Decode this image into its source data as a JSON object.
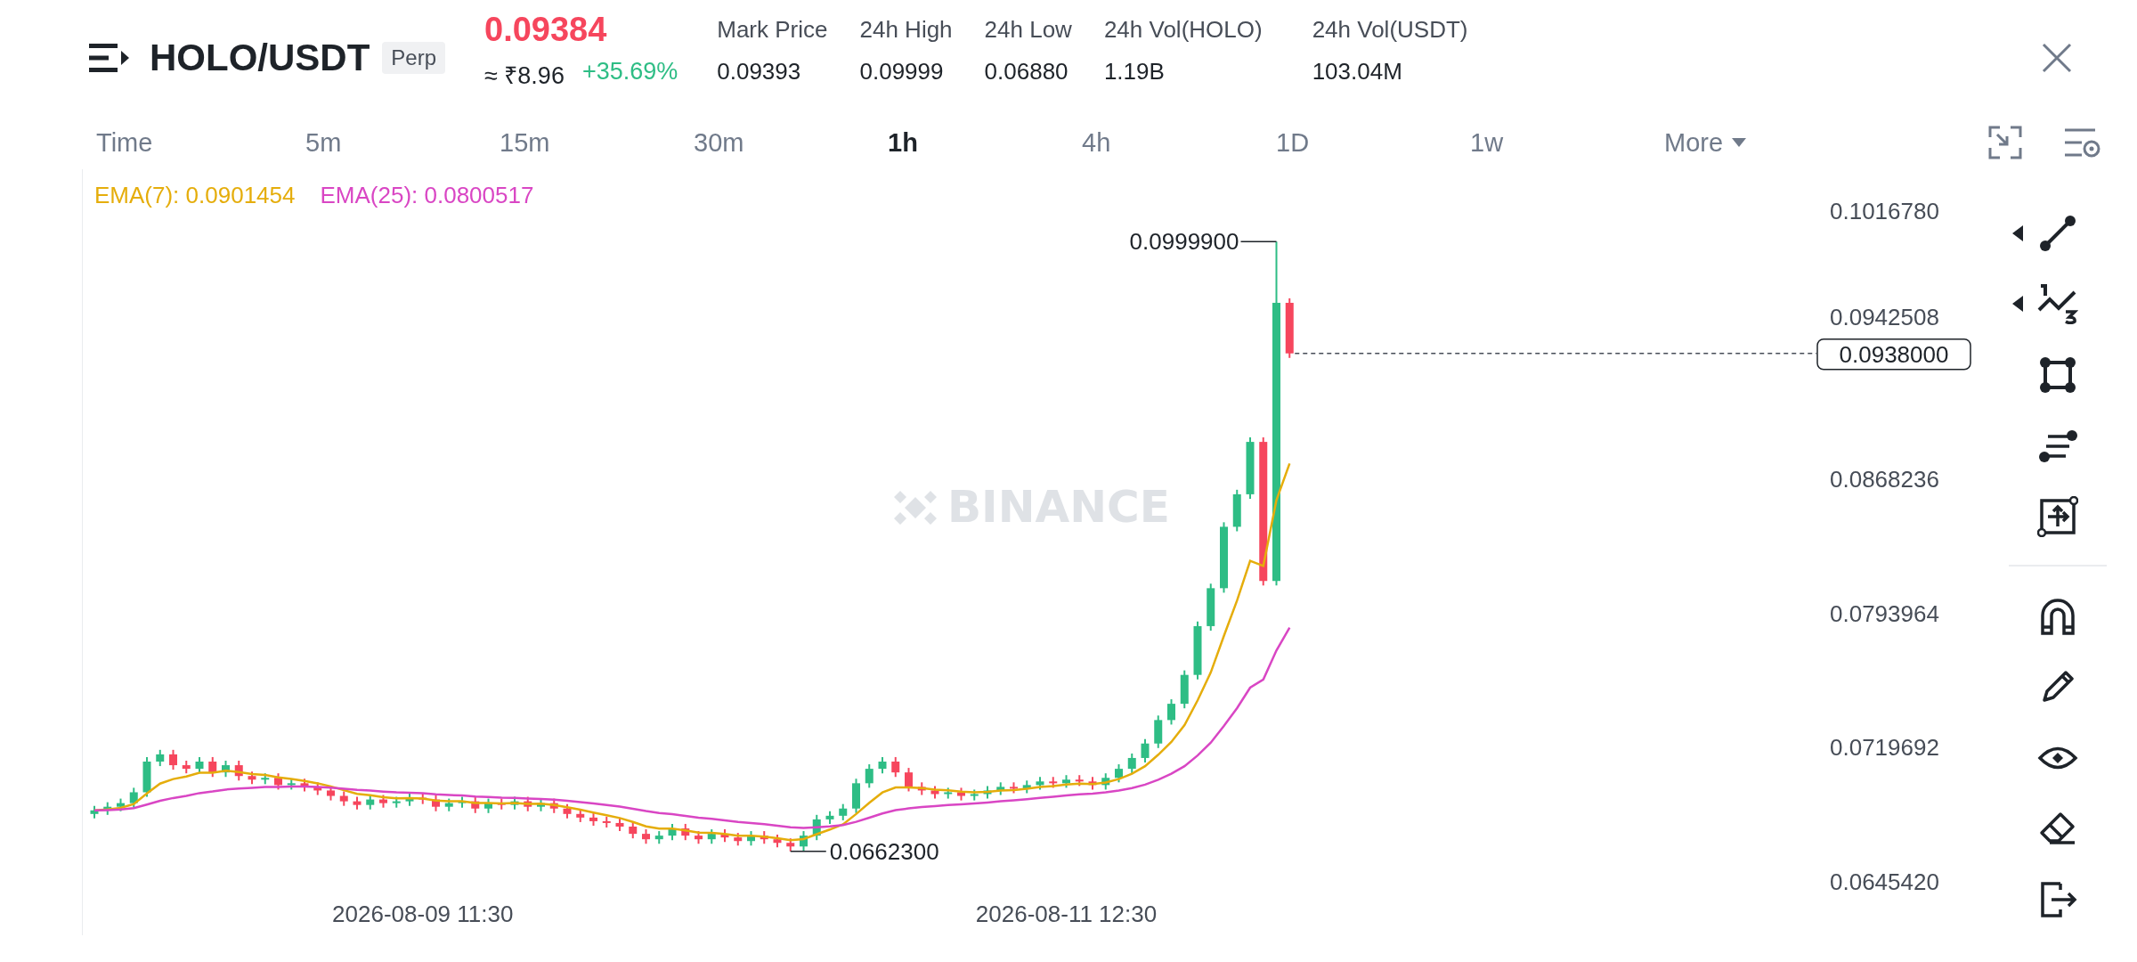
{
  "header": {
    "symbol": "HOLO/USDT",
    "contract": "Perp",
    "price": "0.09384",
    "fiat_price": "≈ ₹8.96",
    "change": "+35.69%",
    "stats": [
      {
        "label": "Mark Price",
        "value": "0.09393"
      },
      {
        "label": "24h High",
        "value": "0.09999"
      },
      {
        "label": "24h Low",
        "value": "0.06880"
      },
      {
        "label": "24h Vol(HOLO)",
        "value": "1.19B"
      },
      {
        "label": "24h Vol(USDT)",
        "value": "103.04M"
      }
    ]
  },
  "timeframes": [
    {
      "label": "Time",
      "selected": false
    },
    {
      "label": "5m",
      "selected": false
    },
    {
      "label": "15m",
      "selected": false
    },
    {
      "label": "30m",
      "selected": false
    },
    {
      "label": "1h",
      "selected": true
    },
    {
      "label": "4h",
      "selected": false
    },
    {
      "label": "1D",
      "selected": false
    },
    {
      "label": "1w",
      "selected": false
    }
  ],
  "more": "More",
  "chart": {
    "indicators": [
      {
        "label": "EMA(7): 0.0901454",
        "color": "#e5ad0b"
      },
      {
        "label": "EMA(25): 0.0800517",
        "color": "#d946c4"
      }
    ],
    "watermark": "BINANCE",
    "high_label": "0.0999900",
    "low_label": "0.0662300",
    "last_price": "0.0938000",
    "price_axis": [
      "0.1016780",
      "0.0942508",
      "0.0868236",
      "0.0793964",
      "0.0719692",
      "0.0645420"
    ],
    "time_axis": [
      "2026-08-09 11:30",
      "2026-08-11 12:30"
    ]
  }
}
